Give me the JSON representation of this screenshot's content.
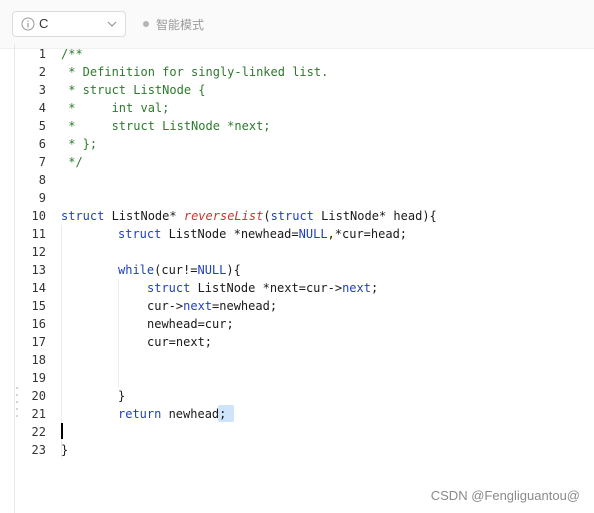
{
  "toolbar": {
    "language": "C",
    "mode_label": "智能模式"
  },
  "editor": {
    "lines": [
      "1",
      "2",
      "3",
      "4",
      "5",
      "6",
      "7",
      "8",
      "9",
      "10",
      "11",
      "12",
      "13",
      "14",
      "15",
      "16",
      "17",
      "18",
      "19",
      "20",
      "21",
      "22",
      "23"
    ],
    "code": {
      "l1": "/**",
      "l2": " * Definition for singly-linked list.",
      "l3": " * struct ListNode {",
      "l4": " *     int val;",
      "l5": " *     struct ListNode *next;",
      "l6": " * };",
      "l7": " */",
      "l10_a": "struct",
      "l10_b": " ListNode* ",
      "l10_c": "reverseList",
      "l10_d": "(",
      "l10_e": "struct",
      "l10_f": " ListNode* ",
      "l10_g": "head",
      "l10_h": "){",
      "l11_a": "struct",
      "l11_b": " ListNode *newhead=",
      "l11_c": "NULL",
      "l11_d": ",*cur=head;",
      "l13_a": "while",
      "l13_b": "(cur!=",
      "l13_c": "NULL",
      "l13_d": "){",
      "l14_a": "struct",
      "l14_b": " ListNode *next=cur->",
      "l14_c": "next",
      "l14_d": ";",
      "l15_a": "cur->",
      "l15_b": "next",
      "l15_c": "=newhead;",
      "l16": "newhead=cur;",
      "l17": "cur=next;",
      "l20": "}",
      "l21_a": "return",
      "l21_b": " newhead;",
      "l23": "}"
    }
  },
  "watermark": "CSDN @Fengliguantou@"
}
